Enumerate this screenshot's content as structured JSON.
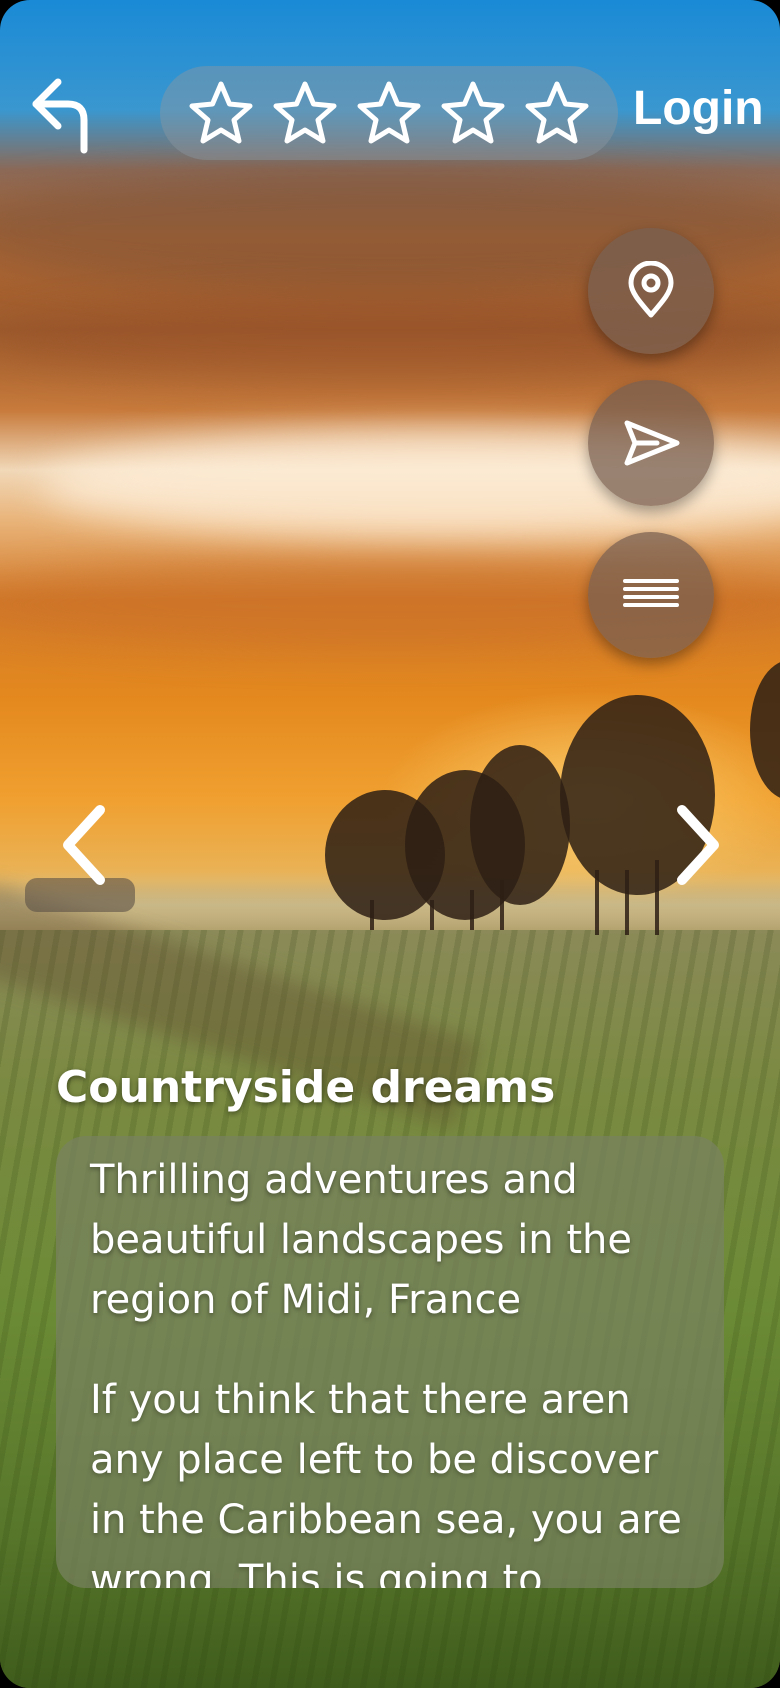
{
  "header": {
    "back_icon": "back-arrow-icon",
    "rating": {
      "stars": 5,
      "filled": 0,
      "icon": "star-outline-icon"
    },
    "login_label": "Login"
  },
  "actions": [
    {
      "name": "location",
      "icon": "map-pin-icon"
    },
    {
      "name": "send",
      "icon": "paper-plane-icon"
    },
    {
      "name": "menu",
      "icon": "menu-lines-icon"
    }
  ],
  "carousel": {
    "prev_icon": "chevron-left-icon",
    "next_icon": "chevron-right-icon"
  },
  "content": {
    "title": "Countryside dreams",
    "subtitle": "Thrilling adventures and beautiful landscapes in the region of Midi, France",
    "body": "If you think that there aren any place left to be discover in the Caribbean sea, you are wrong. This is going to"
  },
  "colors": {
    "text": "#ffffff",
    "pill_bg": "#8c96a0",
    "fab_bg": "#785f50",
    "card_bg": "#78825f"
  }
}
